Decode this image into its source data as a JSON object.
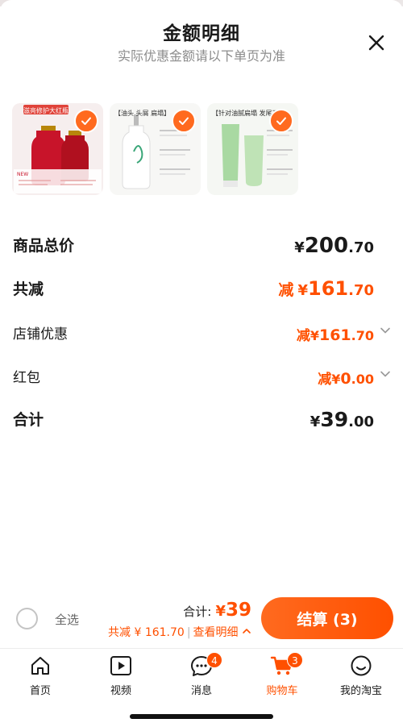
{
  "header": {
    "title": "金额明细",
    "subtitle": "实际优惠金额请以下单页为准"
  },
  "products": [
    {
      "tag": "滋亮修护大红瓶",
      "alt": "红瓶洗发护发套装"
    },
    {
      "tag": "【油头 头屑 扁塌】",
      "alt": "白瓶洗发水"
    },
    {
      "tag": "【针对油腻扁塌 发尾干",
      "alt": "绿色护发素"
    }
  ],
  "summary": {
    "goods_total": {
      "label": "商品总价",
      "currency": "¥",
      "int": "200",
      "dec": ".70"
    },
    "total_reduce": {
      "label": "共减",
      "prefix": "减",
      "currency": "¥",
      "int": "161",
      "dec": ".70"
    },
    "shop_discount": {
      "label": "店铺优惠",
      "prefix": "减",
      "currency": "¥",
      "int": "161",
      "dec": ".70"
    },
    "red_packet": {
      "label": "红包",
      "prefix": "减",
      "currency": "¥",
      "int": "0",
      "dec": ".00"
    },
    "sum": {
      "label": "合计",
      "currency": "¥",
      "int": "39",
      "dec": ".00"
    }
  },
  "bottom_bar": {
    "select_all": "全选",
    "total_label": "合计:",
    "total_currency": "¥",
    "total_value": "39",
    "discount_text": "共减 ¥ 161.70",
    "detail_link": "查看明细",
    "checkout": "结算 (3)"
  },
  "tabbar": [
    {
      "label": "首页",
      "icon": "home-icon"
    },
    {
      "label": "视频",
      "icon": "video-icon"
    },
    {
      "label": "消息",
      "icon": "message-icon",
      "badge": "4"
    },
    {
      "label": "购物车",
      "icon": "cart-icon",
      "badge": "3",
      "active": true
    },
    {
      "label": "我的淘宝",
      "icon": "profile-icon"
    }
  ],
  "colors": {
    "accent": "#ff5000",
    "text": "#1a1a1a",
    "muted": "#8c8c8c"
  }
}
